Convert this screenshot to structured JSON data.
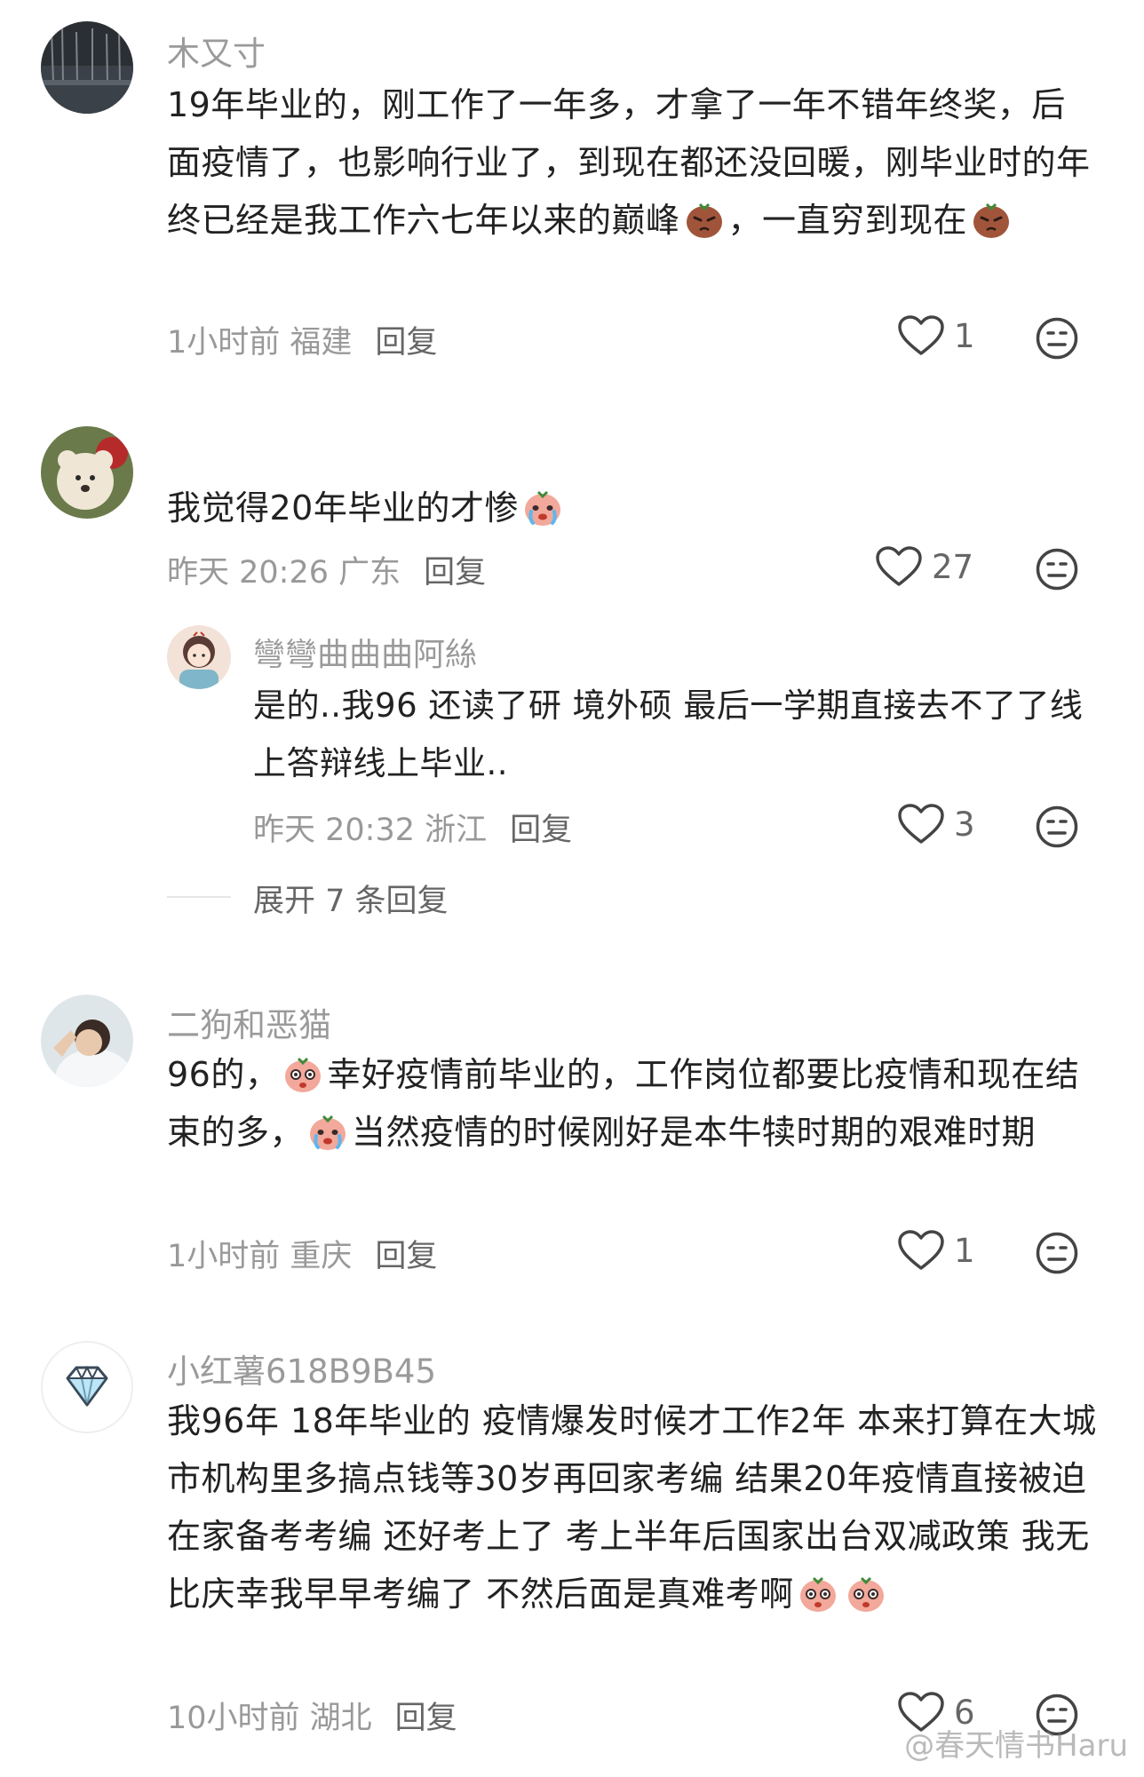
{
  "comments": [
    {
      "username": "木又寸",
      "text_parts": [
        "19年毕业的，刚工作了一年多，才拿了一年不错年终奖，后面疫情了，也影响行业了，到现在都还没回暖，刚毕业时的年终已经是我工作六七年以来的巅峰",
        "，一直穷到现在"
      ],
      "time_location": "1小时前 福建",
      "reply_label": "回复",
      "likes": "1"
    },
    {
      "username": "",
      "text_parts": [
        "我觉得20年毕业的才惨"
      ],
      "time_location": "昨天 20:26 广东",
      "reply_label": "回复",
      "likes": "27",
      "sub_reply": {
        "username": "彎彎曲曲曲阿絲",
        "text": "是的..我96 还读了研 境外硕 最后一学期直接去不了了线上答辩线上毕业..",
        "time_location": "昨天 20:32 浙江",
        "reply_label": "回复",
        "likes": "3"
      },
      "expand_label": "展开 7 条回复"
    },
    {
      "username": "二狗和恶猫",
      "text_parts": [
        "96的，",
        "幸好疫情前毕业的，工作岗位都要比疫情和现在结束的多，",
        "当然疫情的时候刚好是本牛犊时期的艰难时期"
      ],
      "time_location": "1小时前 重庆",
      "reply_label": "回复",
      "likes": "1"
    },
    {
      "username": "小红薯618B9B45",
      "text_parts": [
        "我96年 18年毕业的 疫情爆发时候才工作2年 本来打算在大城市机构里多搞点钱等30岁再回家考编 结果20年疫情直接被迫在家备考考编 还好考上了 考上半年后国家出台双减政策 我无比庆幸我早早考编了 不然后面是真难考啊"
      ],
      "time_location": "10小时前 湖北",
      "reply_label": "回复",
      "likes": "6"
    }
  ],
  "watermark": "@春天情书Haru"
}
